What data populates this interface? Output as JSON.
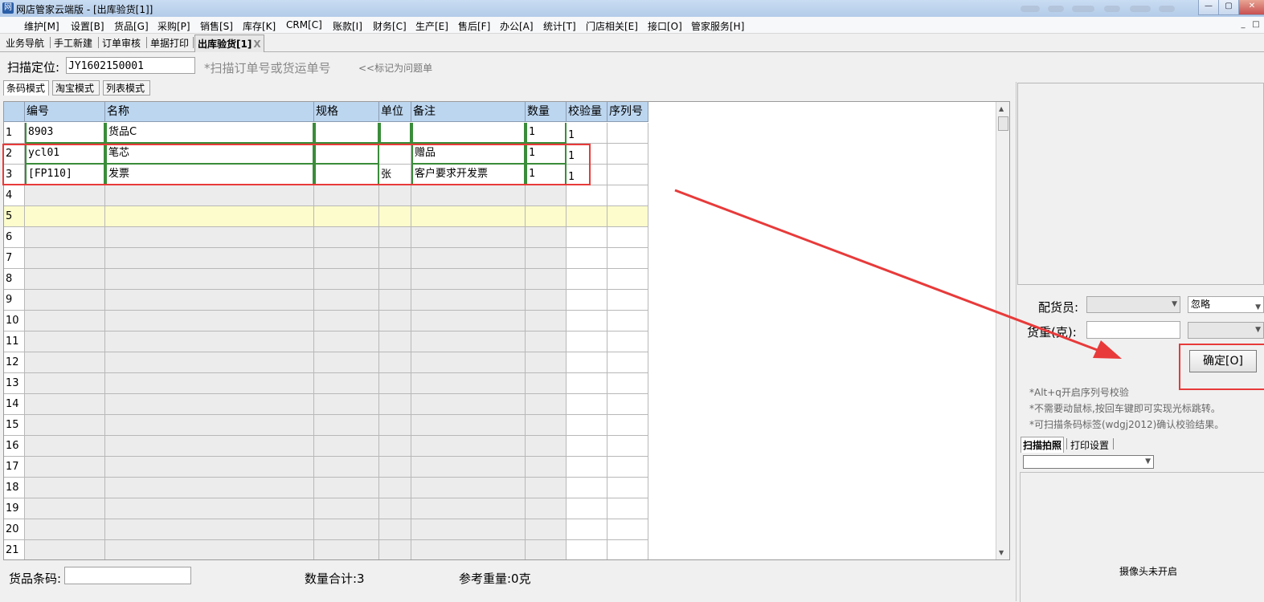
{
  "window": {
    "title": "网店管家云端版 - [出库验货[1]]",
    "icon_letter": "网",
    "min_label": "—",
    "max_label": "▢",
    "close_label": "✕"
  },
  "menu": [
    "维护[M]",
    "设置[B]",
    "货品[G]",
    "采购[P]",
    "销售[S]",
    "库存[K]",
    "CRM[C]",
    "账款[I]",
    "财务[C]",
    "生产[E]",
    "售后[F]",
    "办公[A]",
    "统计[T]",
    "门店相关[E]",
    "接口[O]",
    "管家服务[H]"
  ],
  "tabs": [
    "业务导航",
    "手工新建",
    "订单审核",
    "单据打印",
    "出库验货[1]"
  ],
  "tab_close": "X",
  "scan": {
    "label": "扫描定位:",
    "value": "JY1602150001",
    "hint": "*扫描订单号或货运单号",
    "mark_link": "<<标记为问题单"
  },
  "modes": [
    "条码模式",
    "淘宝模式",
    "列表模式"
  ],
  "grid": {
    "columns": [
      "编号",
      "名称",
      "规格",
      "单位",
      "备注",
      "数量",
      "校验量",
      "序列号"
    ],
    "rows": [
      {
        "num": "1",
        "code": "8903",
        "name": "货品C",
        "spec": "",
        "unit": "",
        "note": "",
        "qty": "1",
        "check": "1",
        "serial": ""
      },
      {
        "num": "2",
        "code": "ycl01",
        "name": "笔芯",
        "spec": "",
        "unit": "",
        "note": "赠品",
        "qty": "1",
        "check": "1",
        "serial": ""
      },
      {
        "num": "3",
        "code": "[FP110]",
        "name": "发票",
        "spec": "",
        "unit": "张",
        "note": "客户要求开发票",
        "qty": "1",
        "check": "1",
        "serial": ""
      }
    ],
    "empty_rows": [
      "4",
      "5",
      "6",
      "7",
      "8",
      "9",
      "10",
      "11",
      "12",
      "13",
      "14",
      "15",
      "16",
      "17",
      "18",
      "19",
      "20",
      "21"
    ],
    "selected_row": "5"
  },
  "footer": {
    "barcode_label": "货品条码:",
    "qty_total": "数量合计:3",
    "ref_weight": "参考重量:0克"
  },
  "right": {
    "picker_label": "配货员:",
    "ignore_value": "忽略",
    "weight_label": "货重(克):",
    "confirm_label": "确定[O]",
    "notes": [
      "*Alt+q开启序列号校验",
      "*不需要动鼠标,按回车键即可实现光标跳转。",
      "*可扫描条码标签(wdgj2012)确认校验结果。"
    ],
    "tabs": [
      "扫描拍照",
      "打印设置"
    ],
    "camera_status": "摄像头未开启"
  },
  "colors": {
    "annotation": "#e83a3a",
    "header": "#bcd6f0",
    "selected_row": "#fdfccc",
    "edit_border": "#3a8c3a"
  }
}
